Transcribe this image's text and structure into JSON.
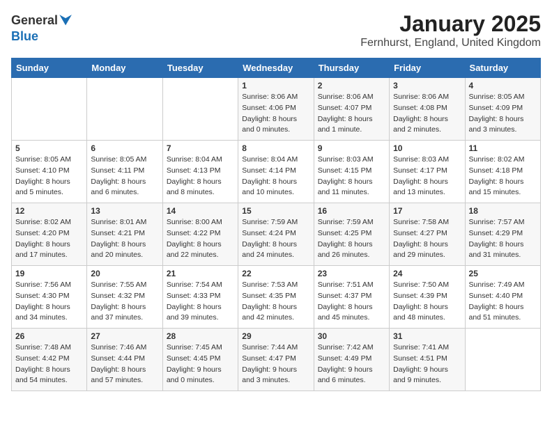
{
  "logo": {
    "general": "General",
    "blue": "Blue"
  },
  "title": "January 2025",
  "location": "Fernhurst, England, United Kingdom",
  "headers": [
    "Sunday",
    "Monday",
    "Tuesday",
    "Wednesday",
    "Thursday",
    "Friday",
    "Saturday"
  ],
  "weeks": [
    [
      {
        "day": "",
        "info": ""
      },
      {
        "day": "",
        "info": ""
      },
      {
        "day": "",
        "info": ""
      },
      {
        "day": "1",
        "info": "Sunrise: 8:06 AM\nSunset: 4:06 PM\nDaylight: 8 hours\nand 0 minutes."
      },
      {
        "day": "2",
        "info": "Sunrise: 8:06 AM\nSunset: 4:07 PM\nDaylight: 8 hours\nand 1 minute."
      },
      {
        "day": "3",
        "info": "Sunrise: 8:06 AM\nSunset: 4:08 PM\nDaylight: 8 hours\nand 2 minutes."
      },
      {
        "day": "4",
        "info": "Sunrise: 8:05 AM\nSunset: 4:09 PM\nDaylight: 8 hours\nand 3 minutes."
      }
    ],
    [
      {
        "day": "5",
        "info": "Sunrise: 8:05 AM\nSunset: 4:10 PM\nDaylight: 8 hours\nand 5 minutes."
      },
      {
        "day": "6",
        "info": "Sunrise: 8:05 AM\nSunset: 4:11 PM\nDaylight: 8 hours\nand 6 minutes."
      },
      {
        "day": "7",
        "info": "Sunrise: 8:04 AM\nSunset: 4:13 PM\nDaylight: 8 hours\nand 8 minutes."
      },
      {
        "day": "8",
        "info": "Sunrise: 8:04 AM\nSunset: 4:14 PM\nDaylight: 8 hours\nand 10 minutes."
      },
      {
        "day": "9",
        "info": "Sunrise: 8:03 AM\nSunset: 4:15 PM\nDaylight: 8 hours\nand 11 minutes."
      },
      {
        "day": "10",
        "info": "Sunrise: 8:03 AM\nSunset: 4:17 PM\nDaylight: 8 hours\nand 13 minutes."
      },
      {
        "day": "11",
        "info": "Sunrise: 8:02 AM\nSunset: 4:18 PM\nDaylight: 8 hours\nand 15 minutes."
      }
    ],
    [
      {
        "day": "12",
        "info": "Sunrise: 8:02 AM\nSunset: 4:20 PM\nDaylight: 8 hours\nand 17 minutes."
      },
      {
        "day": "13",
        "info": "Sunrise: 8:01 AM\nSunset: 4:21 PM\nDaylight: 8 hours\nand 20 minutes."
      },
      {
        "day": "14",
        "info": "Sunrise: 8:00 AM\nSunset: 4:22 PM\nDaylight: 8 hours\nand 22 minutes."
      },
      {
        "day": "15",
        "info": "Sunrise: 7:59 AM\nSunset: 4:24 PM\nDaylight: 8 hours\nand 24 minutes."
      },
      {
        "day": "16",
        "info": "Sunrise: 7:59 AM\nSunset: 4:25 PM\nDaylight: 8 hours\nand 26 minutes."
      },
      {
        "day": "17",
        "info": "Sunrise: 7:58 AM\nSunset: 4:27 PM\nDaylight: 8 hours\nand 29 minutes."
      },
      {
        "day": "18",
        "info": "Sunrise: 7:57 AM\nSunset: 4:29 PM\nDaylight: 8 hours\nand 31 minutes."
      }
    ],
    [
      {
        "day": "19",
        "info": "Sunrise: 7:56 AM\nSunset: 4:30 PM\nDaylight: 8 hours\nand 34 minutes."
      },
      {
        "day": "20",
        "info": "Sunrise: 7:55 AM\nSunset: 4:32 PM\nDaylight: 8 hours\nand 37 minutes."
      },
      {
        "day": "21",
        "info": "Sunrise: 7:54 AM\nSunset: 4:33 PM\nDaylight: 8 hours\nand 39 minutes."
      },
      {
        "day": "22",
        "info": "Sunrise: 7:53 AM\nSunset: 4:35 PM\nDaylight: 8 hours\nand 42 minutes."
      },
      {
        "day": "23",
        "info": "Sunrise: 7:51 AM\nSunset: 4:37 PM\nDaylight: 8 hours\nand 45 minutes."
      },
      {
        "day": "24",
        "info": "Sunrise: 7:50 AM\nSunset: 4:39 PM\nDaylight: 8 hours\nand 48 minutes."
      },
      {
        "day": "25",
        "info": "Sunrise: 7:49 AM\nSunset: 4:40 PM\nDaylight: 8 hours\nand 51 minutes."
      }
    ],
    [
      {
        "day": "26",
        "info": "Sunrise: 7:48 AM\nSunset: 4:42 PM\nDaylight: 8 hours\nand 54 minutes."
      },
      {
        "day": "27",
        "info": "Sunrise: 7:46 AM\nSunset: 4:44 PM\nDaylight: 8 hours\nand 57 minutes."
      },
      {
        "day": "28",
        "info": "Sunrise: 7:45 AM\nSunset: 4:45 PM\nDaylight: 9 hours\nand 0 minutes."
      },
      {
        "day": "29",
        "info": "Sunrise: 7:44 AM\nSunset: 4:47 PM\nDaylight: 9 hours\nand 3 minutes."
      },
      {
        "day": "30",
        "info": "Sunrise: 7:42 AM\nSunset: 4:49 PM\nDaylight: 9 hours\nand 6 minutes."
      },
      {
        "day": "31",
        "info": "Sunrise: 7:41 AM\nSunset: 4:51 PM\nDaylight: 9 hours\nand 9 minutes."
      },
      {
        "day": "",
        "info": ""
      }
    ]
  ]
}
